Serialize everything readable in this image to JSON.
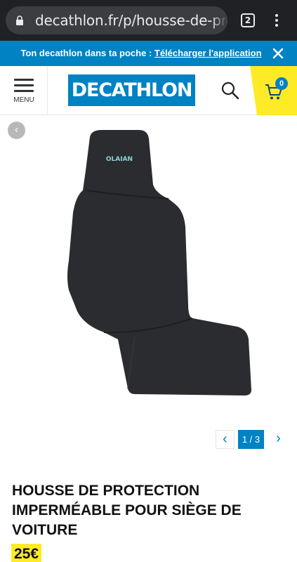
{
  "browser": {
    "url": "decathlon.fr/p/housse-de-prot",
    "tab_count": "2",
    "icons": [
      "lock-icon",
      "tab-switcher-icon",
      "more-options-icon"
    ]
  },
  "promo_banner": {
    "text": "Ton decathlon dans ta poche : ",
    "link_label": "Télécharger l'application",
    "close_icon": "close-icon"
  },
  "header": {
    "menu_label": "MENU",
    "logo_text": "DECATHLON",
    "cart_count": "0",
    "icons": [
      "hamburger-menu-icon",
      "search-icon",
      "cart-icon"
    ]
  },
  "gallery": {
    "prev_icon": "chevron-left-icon",
    "image_brand_text": "OLAIAN",
    "pager": "1 / 3",
    "pager_prev_icon": "chevron-left-icon",
    "pager_next_icon": "chevron-right-icon"
  },
  "product": {
    "title": "HOUSSE DE PROTECTION IMPERMÉABLE POUR SIÈGE DE VOITURE",
    "price": "25€"
  },
  "colors": {
    "brand_blue": "#0082c3",
    "brand_yellow": "#ffea28",
    "browser_chrome": "#202124"
  }
}
